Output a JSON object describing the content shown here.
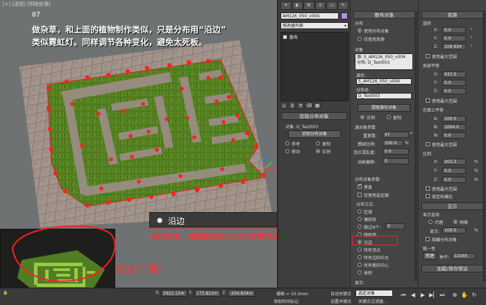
{
  "viewport": {
    "label": "[+] [透视] [明暗处理]",
    "step": "07",
    "instruction_line1": "做杂草，和上面的植物制作类似，只是分布用“沿边”",
    "instruction_line2": "类似霓虹灯。同样调节各种变化，避免太死板。",
    "caption": "沿边",
    "annotation": "沿边分布，做霓虹灯也可以用这种方式",
    "use_this": "用这个“匾”"
  },
  "status": {
    "x_label": "X:",
    "x_value": "2922.124r",
    "y_label": "Y:",
    "y_value": "173.812m",
    "z_label": "Z:",
    "z_value": "-204.834m",
    "grid": "栅格 = 10.0mm",
    "add_time_tag": "添加时间标记",
    "auto_key": "自动关键点",
    "selected_object": "选定对象",
    "set_key": "设置关键点",
    "key_filters": "关键点过滤器..."
  },
  "panel1": {
    "cmd_tabs": [
      "✦",
      "◐",
      "⚙",
      "⊙",
      "▭",
      "✎"
    ],
    "object_name": "AM126_050_v004",
    "modifier_list": "修改器列表",
    "stack_item": "散布",
    "rollout_pick": "拾取分布对象",
    "object_label": "对象: D_Text003",
    "pick_button": "拾取分布对象",
    "radios": [
      "参考",
      "复制",
      "移动",
      "实例"
    ]
  },
  "panel2": {
    "rollout_scatter": "散布对象",
    "group_scatter": "分布",
    "opt_use_dist": "使用分布对象",
    "opt_transform_only": "仅使用变换",
    "group_object": "对象",
    "object_list": [
      "源: S_AM126_050_v004",
      "分布: D_Text003"
    ],
    "source_name_label": "源名:",
    "source_name": "S_AM126_050_v004",
    "dist_name_label": "分布名:",
    "dist_name": "D_Text003",
    "extract_button": "提取操作对象",
    "radio_instance": "实例",
    "radio_copy": "复制",
    "group_source_params": "源对象参数",
    "dup_label": "重复数:",
    "dup_value": "47",
    "base_scale_label": "基础比例:",
    "base_scale_value": "100.0",
    "vertex_chaos_label": "顶点混乱度:",
    "vertex_chaos_value": "0.0",
    "anim_offset_label": "动画偏移:",
    "anim_offset_value": "0",
    "group_dist_params": "分布对象参数",
    "check_perpendicular": "垂直",
    "check_selected_faces": "仅使用选定面",
    "distribute_by": "分布方式:",
    "dist_options": [
      "区域",
      "偶校验",
      "跳过N个:",
      "随机面",
      "沿边",
      "所有顶点",
      "所有边的中点",
      "所有面的中心",
      "体积"
    ],
    "skip_value": "0",
    "display_label": "显示:"
  },
  "panel3": {
    "rollout_transform": "变换",
    "group_rotation": "旋转",
    "rot": [
      {
        "axis": "X:",
        "value": "0.0"
      },
      {
        "axis": "Y:",
        "value": "0.0"
      },
      {
        "axis": "Z:",
        "value": "106.634"
      }
    ],
    "uniform_check_1": "使用最大范围",
    "group_local_translate": "局部平移",
    "lt": [
      {
        "axis": "X:",
        "value": "437.0"
      },
      {
        "axis": "Y:",
        "value": "0.0"
      },
      {
        "axis": "Z:",
        "value": "0.0"
      }
    ],
    "uniform_check_2": "使用最大范围",
    "group_face_translate": "在面上平移",
    "ft": [
      {
        "axis": "A:",
        "value": "100.0"
      },
      {
        "axis": "B:",
        "value": "1004.0"
      },
      {
        "axis": "N:",
        "value": "0.0"
      }
    ],
    "uniform_check_3": "使用最大范围",
    "group_scale": "比例",
    "sc": [
      {
        "axis": "X:",
        "value": "203.3"
      },
      {
        "axis": "Y:",
        "value": "0.0"
      },
      {
        "axis": "Z:",
        "value": "0.0"
      }
    ],
    "percent": "%",
    "uniform_check_4": "使用最大范围",
    "lock_aspect": "锁定纵横比",
    "rollout_display": "显示",
    "group_display_options": "显示选项",
    "radio_proxy": "代理",
    "radio_mesh": "网格",
    "display_label": "显示:",
    "display_value": "100.0",
    "hide_dist": "隐藏分布对象",
    "group_unique": "唯一性",
    "new_button": "新建",
    "seed_label": "种子:",
    "seed_value": "12345",
    "rollout_load": "加载/保存预设"
  },
  "colors": {
    "accent_red": "#ff2020",
    "swatch": "#b48ee8"
  }
}
